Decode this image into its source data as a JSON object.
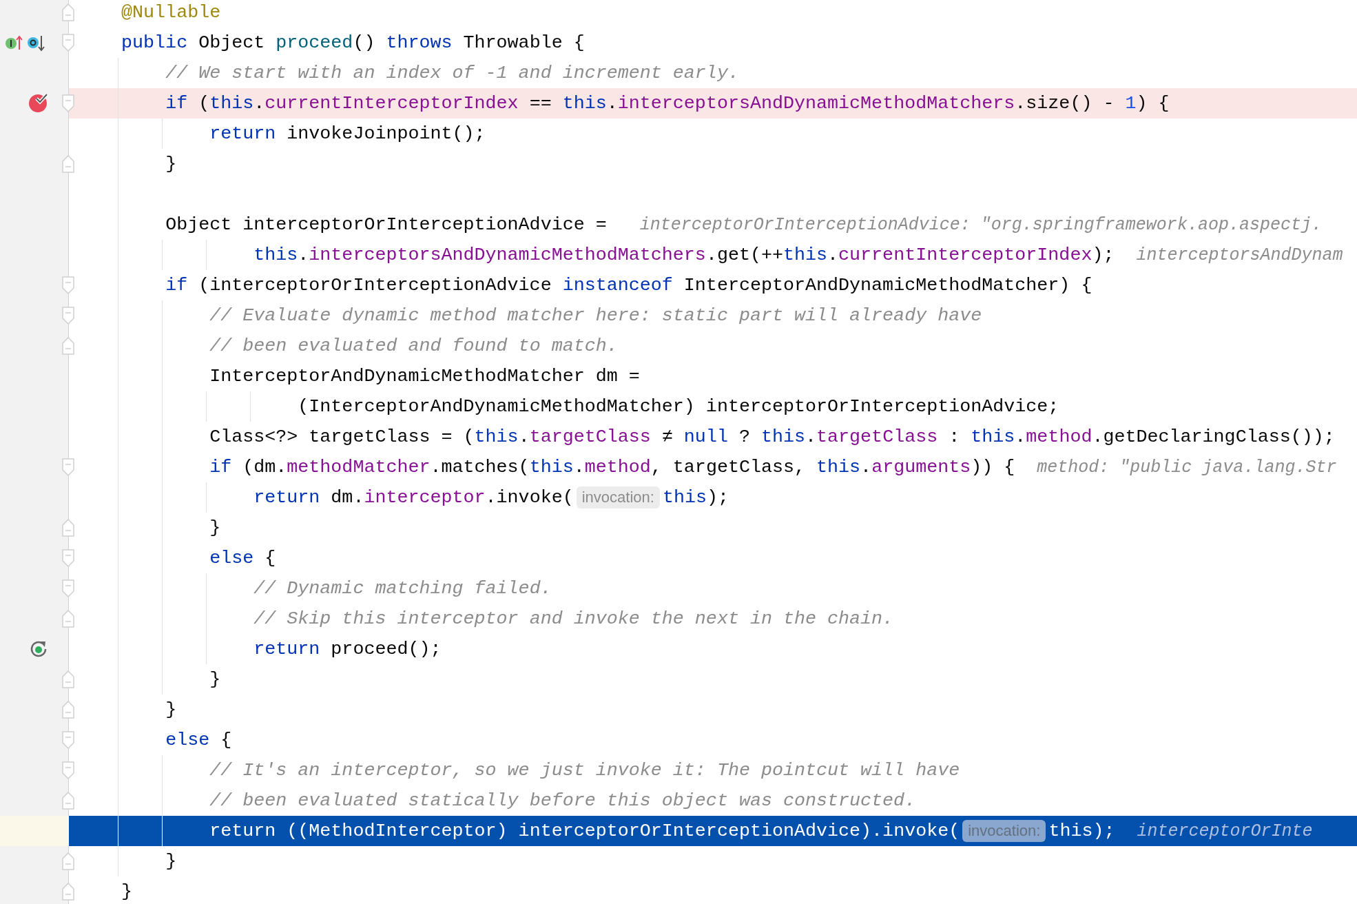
{
  "editor": {
    "lines": [
      {
        "fold": {
          "kind": "end"
        },
        "tokens": [
          {
            "kind": "annotation",
            "text": "    @Nullable"
          }
        ]
      },
      {
        "fold": {
          "kind": "start"
        },
        "gutter_icon": {
          "kind": "overrides"
        },
        "tokens": [
          {
            "kind": "keyword",
            "text": "    public"
          },
          {
            "kind": "plain",
            "text": " Object "
          },
          {
            "kind": "method",
            "text": "proceed"
          },
          {
            "kind": "plain",
            "text": "() "
          },
          {
            "kind": "keyword",
            "text": "throws"
          },
          {
            "kind": "plain",
            "text": " Throwable {"
          }
        ]
      },
      {
        "tokens": [
          {
            "kind": "comment",
            "text": "        // We start with an index of -1 and increment early."
          }
        ]
      },
      {
        "fold": {
          "kind": "start"
        },
        "gutter_icon": {
          "kind": "breakpoint"
        },
        "highlight": {
          "kind": "breakpoint"
        },
        "tokens": [
          {
            "kind": "keyword",
            "text": "        if"
          },
          {
            "kind": "plain",
            "text": " ("
          },
          {
            "kind": "keyword",
            "text": "this"
          },
          {
            "kind": "plain",
            "text": "."
          },
          {
            "kind": "field",
            "text": "currentInterceptorIndex"
          },
          {
            "kind": "plain",
            "text": " == "
          },
          {
            "kind": "keyword",
            "text": "this"
          },
          {
            "kind": "plain",
            "text": "."
          },
          {
            "kind": "field",
            "text": "interceptorsAndDynamicMethodMatchers"
          },
          {
            "kind": "plain",
            "text": ".size() - "
          },
          {
            "kind": "number",
            "text": "1"
          },
          {
            "kind": "plain",
            "text": ") {"
          }
        ]
      },
      {
        "tokens": [
          {
            "kind": "keyword",
            "text": "            return"
          },
          {
            "kind": "plain",
            "text": " invokeJoinpoint();"
          }
        ]
      },
      {
        "fold": {
          "kind": "end"
        },
        "tokens": [
          {
            "kind": "plain",
            "text": "        }"
          }
        ]
      },
      {
        "kind": "blank"
      },
      {
        "tokens": [
          {
            "kind": "plain",
            "text": "        Object interceptorOrInterceptionAdvice = "
          },
          {
            "kind": "value_hint",
            "text": "interceptorOrInterceptionAdvice: \"org.springframework.aop.aspectj."
          }
        ]
      },
      {
        "tokens": [
          {
            "kind": "keyword",
            "text": "                this"
          },
          {
            "kind": "plain",
            "text": "."
          },
          {
            "kind": "field",
            "text": "interceptorsAndDynamicMethodMatchers"
          },
          {
            "kind": "plain",
            "text": ".get(++"
          },
          {
            "kind": "keyword",
            "text": "this"
          },
          {
            "kind": "plain",
            "text": "."
          },
          {
            "kind": "field",
            "text": "currentInterceptorIndex"
          },
          {
            "kind": "plain",
            "text": ");"
          },
          {
            "kind": "value_hint",
            "text": "interceptorsAndDynam"
          }
        ]
      },
      {
        "fold": {
          "kind": "start"
        },
        "tokens": [
          {
            "kind": "keyword",
            "text": "        if"
          },
          {
            "kind": "plain",
            "text": " (interceptorOrInterceptionAdvice "
          },
          {
            "kind": "keyword",
            "text": "instanceof"
          },
          {
            "kind": "plain",
            "text": " InterceptorAndDynamicMethodMatcher) {"
          }
        ]
      },
      {
        "fold": {
          "kind": "start"
        },
        "tokens": [
          {
            "kind": "comment",
            "text": "            // Evaluate dynamic method matcher here: static part will already have"
          }
        ]
      },
      {
        "fold": {
          "kind": "end"
        },
        "tokens": [
          {
            "kind": "comment",
            "text": "            // been evaluated and found to match."
          }
        ]
      },
      {
        "tokens": [
          {
            "kind": "plain",
            "text": "            InterceptorAndDynamicMethodMatcher dm ="
          }
        ]
      },
      {
        "tokens": [
          {
            "kind": "plain",
            "text": "                    (InterceptorAndDynamicMethodMatcher) interceptorOrInterceptionAdvice;"
          }
        ]
      },
      {
        "tokens": [
          {
            "kind": "plain",
            "text": "            Class<?> targetClass = ("
          },
          {
            "kind": "keyword",
            "text": "this"
          },
          {
            "kind": "plain",
            "text": "."
          },
          {
            "kind": "field",
            "text": "targetClass"
          },
          {
            "kind": "plain",
            "text": " ≠ "
          },
          {
            "kind": "keyword",
            "text": "null"
          },
          {
            "kind": "plain",
            "text": " ? "
          },
          {
            "kind": "keyword",
            "text": "this"
          },
          {
            "kind": "plain",
            "text": "."
          },
          {
            "kind": "field",
            "text": "targetClass"
          },
          {
            "kind": "plain",
            "text": " : "
          },
          {
            "kind": "keyword",
            "text": "this"
          },
          {
            "kind": "plain",
            "text": "."
          },
          {
            "kind": "field",
            "text": "method"
          },
          {
            "kind": "plain",
            "text": ".getDeclaringClass());"
          }
        ]
      },
      {
        "fold": {
          "kind": "start"
        },
        "tokens": [
          {
            "kind": "keyword",
            "text": "            if"
          },
          {
            "kind": "plain",
            "text": " (dm."
          },
          {
            "kind": "field",
            "text": "methodMatcher"
          },
          {
            "kind": "plain",
            "text": ".matches("
          },
          {
            "kind": "keyword",
            "text": "this"
          },
          {
            "kind": "plain",
            "text": "."
          },
          {
            "kind": "field",
            "text": "method"
          },
          {
            "kind": "plain",
            "text": ", targetClass, "
          },
          {
            "kind": "keyword",
            "text": "this"
          },
          {
            "kind": "plain",
            "text": "."
          },
          {
            "kind": "field",
            "text": "arguments"
          },
          {
            "kind": "plain",
            "text": ")) {"
          },
          {
            "kind": "value_hint",
            "text": "method: \"public java.lang.Str"
          }
        ]
      },
      {
        "tokens": [
          {
            "kind": "keyword",
            "text": "                return"
          },
          {
            "kind": "plain",
            "text": " dm."
          },
          {
            "kind": "field",
            "text": "interceptor"
          },
          {
            "kind": "plain",
            "text": ".invoke("
          },
          {
            "kind": "param_hint",
            "text": "invocation:"
          },
          {
            "kind": "keyword",
            "text": "this"
          },
          {
            "kind": "plain",
            "text": ");"
          }
        ]
      },
      {
        "fold": {
          "kind": "end"
        },
        "tokens": [
          {
            "kind": "plain",
            "text": "            }"
          }
        ]
      },
      {
        "fold": {
          "kind": "start"
        },
        "tokens": [
          {
            "kind": "keyword",
            "text": "            else"
          },
          {
            "kind": "plain",
            "text": " {"
          }
        ]
      },
      {
        "fold": {
          "kind": "start"
        },
        "tokens": [
          {
            "kind": "comment",
            "text": "                // Dynamic matching failed."
          }
        ]
      },
      {
        "fold": {
          "kind": "end"
        },
        "tokens": [
          {
            "kind": "comment",
            "text": "                // Skip this interceptor and invoke the next in the chain."
          }
        ]
      },
      {
        "gutter_icon": {
          "kind": "recursion"
        },
        "tokens": [
          {
            "kind": "keyword",
            "text": "                return"
          },
          {
            "kind": "plain",
            "text": " proceed();"
          }
        ]
      },
      {
        "fold": {
          "kind": "end"
        },
        "tokens": [
          {
            "kind": "plain",
            "text": "            }"
          }
        ]
      },
      {
        "fold": {
          "kind": "end"
        },
        "tokens": [
          {
            "kind": "plain",
            "text": "        }"
          }
        ]
      },
      {
        "fold": {
          "kind": "start"
        },
        "tokens": [
          {
            "kind": "keyword",
            "text": "        else"
          },
          {
            "kind": "plain",
            "text": " {"
          }
        ]
      },
      {
        "fold": {
          "kind": "start"
        },
        "tokens": [
          {
            "kind": "comment",
            "text": "            // It's an interceptor, so we just invoke it: The pointcut will have"
          }
        ]
      },
      {
        "fold": {
          "kind": "end"
        },
        "tokens": [
          {
            "kind": "comment",
            "text": "            // been evaluated statically before this object was constructed."
          }
        ]
      },
      {
        "highlight": {
          "kind": "execution"
        },
        "tokens": [
          {
            "kind": "keyword",
            "text": "            return"
          },
          {
            "kind": "plain",
            "text": " ((MethodInterceptor) interceptorOrInterceptionAdvice).invoke("
          },
          {
            "kind": "param_hint",
            "text": "invocation:"
          },
          {
            "kind": "plain",
            "text": "this);"
          },
          {
            "kind": "value_hint",
            "text": "interceptorOrInte"
          }
        ]
      },
      {
        "fold": {
          "kind": "end"
        },
        "tokens": [
          {
            "kind": "plain",
            "text": "        }"
          }
        ]
      },
      {
        "fold": {
          "kind": "end"
        },
        "tokens": [
          {
            "kind": "plain",
            "text": "    }"
          }
        ]
      }
    ]
  }
}
